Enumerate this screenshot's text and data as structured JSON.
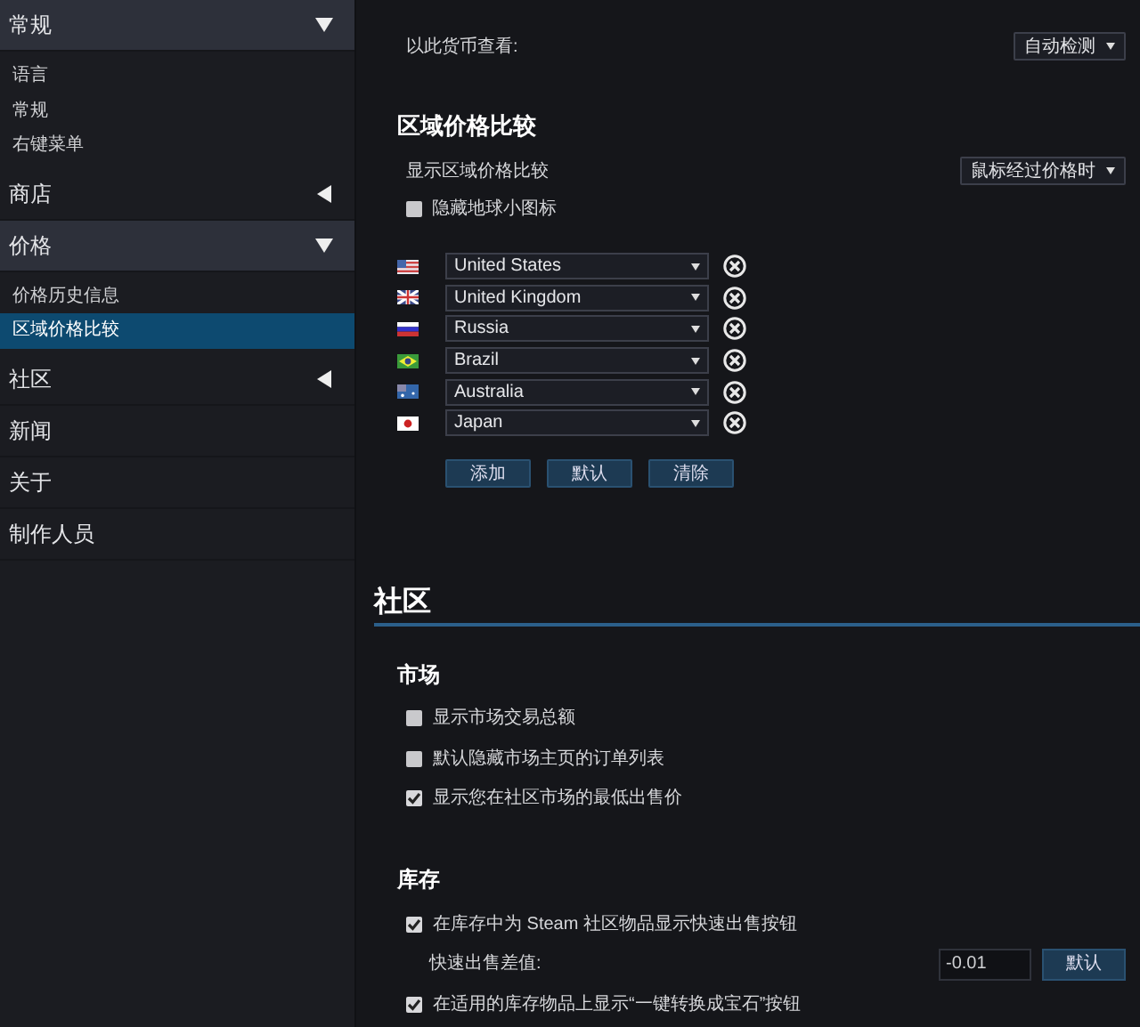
{
  "sidebar": [
    {
      "kind": "group",
      "label": "常规",
      "expanded": true,
      "children": [
        {
          "label": "语言",
          "selected": false
        },
        {
          "label": "常规",
          "selected": false
        },
        {
          "label": "右键菜单",
          "selected": false
        }
      ]
    },
    {
      "kind": "group",
      "label": "商店",
      "expanded": false
    },
    {
      "kind": "group",
      "label": "价格",
      "expanded": true,
      "children": [
        {
          "label": "价格历史信息",
          "selected": false
        },
        {
          "label": "区域价格比较",
          "selected": true
        }
      ]
    },
    {
      "kind": "group",
      "label": "社区",
      "expanded": false
    },
    {
      "kind": "link",
      "label": "新闻"
    },
    {
      "kind": "link",
      "label": "关于"
    },
    {
      "kind": "link",
      "label": "制作人员"
    }
  ],
  "currency": {
    "label": "以此货币查看:",
    "value": "自动检测"
  },
  "region_compare": {
    "title": "区域价格比较",
    "display": {
      "label": "显示区域价格比较",
      "value": "鼠标经过价格时"
    },
    "hide_icon": {
      "label": "隐藏地球小图标",
      "checked": false
    },
    "countries": [
      {
        "kind": "us",
        "name": "United States"
      },
      {
        "kind": "gb",
        "name": "United Kingdom"
      },
      {
        "kind": "ru",
        "name": "Russia"
      },
      {
        "kind": "br",
        "name": "Brazil"
      },
      {
        "kind": "au",
        "name": "Australia"
      },
      {
        "kind": "jp",
        "name": "Japan"
      }
    ],
    "buttons": [
      "添加",
      "默认",
      "清除"
    ]
  },
  "community": {
    "title": "社区",
    "sections": [
      {
        "title": "市场",
        "items": [
          {
            "kind": "checkbox",
            "label": "显示市场交易总额",
            "checked": false
          },
          {
            "kind": "checkbox",
            "label": "默认隐藏市场主页的订单列表",
            "checked": false
          },
          {
            "kind": "checkbox",
            "label": "显示您在社区市场的最低出售价",
            "checked": true
          }
        ]
      },
      {
        "title": "库存",
        "items": [
          {
            "kind": "checkbox",
            "label": "在库存中为 Steam 社区物品显示快速出售按钮",
            "checked": true
          },
          {
            "kind": "input",
            "label": "快速出售差值:",
            "value": "-0.01",
            "button": "默认"
          },
          {
            "kind": "checkbox",
            "label": "在适用的库存物品上显示“一键转换成宝石”按钮",
            "checked": true
          }
        ]
      }
    ]
  }
}
